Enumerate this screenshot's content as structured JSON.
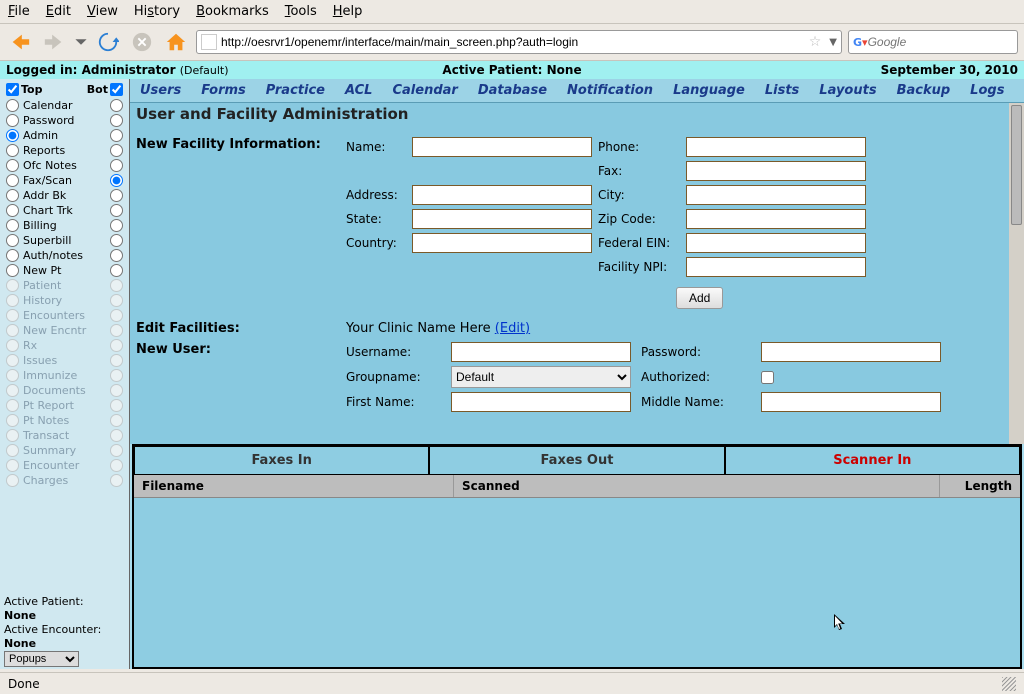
{
  "browser": {
    "menu": [
      "File",
      "Edit",
      "View",
      "History",
      "Bookmarks",
      "Tools",
      "Help"
    ],
    "url": "http://oesrvr1/openemr/interface/main/main_screen.php?auth=login",
    "search_placeholder": "Google"
  },
  "statusbar": {
    "logged_in_label": "Logged in: ",
    "user": "Administrator",
    "user_default": "(Default)",
    "active_patient_label": "Active Patient: ",
    "active_patient": "None",
    "date": "September 30, 2010"
  },
  "sidebar": {
    "top_label": "Top",
    "bot_label": "Bot",
    "items": [
      {
        "label": "Calendar",
        "enabled": true,
        "sel": false
      },
      {
        "label": "Password",
        "enabled": true,
        "sel": false
      },
      {
        "label": "Admin",
        "enabled": true,
        "sel": true
      },
      {
        "label": "Reports",
        "enabled": true,
        "sel": false
      },
      {
        "label": "Ofc Notes",
        "enabled": true,
        "sel": false
      },
      {
        "label": "Fax/Scan",
        "enabled": true,
        "sel": false,
        "botsel": true
      },
      {
        "label": "Addr Bk",
        "enabled": true,
        "sel": false
      },
      {
        "label": "Chart Trk",
        "enabled": true,
        "sel": false
      },
      {
        "label": "Billing",
        "enabled": true,
        "sel": false
      },
      {
        "label": "Superbill",
        "enabled": true,
        "sel": false
      },
      {
        "label": "Auth/notes",
        "enabled": true,
        "sel": false
      },
      {
        "label": "New Pt",
        "enabled": true,
        "sel": false
      },
      {
        "label": "Patient",
        "enabled": false
      },
      {
        "label": "History",
        "enabled": false
      },
      {
        "label": "Encounters",
        "enabled": false
      },
      {
        "label": "New Encntr",
        "enabled": false
      },
      {
        "label": "Rx",
        "enabled": false
      },
      {
        "label": "Issues",
        "enabled": false
      },
      {
        "label": "Immunize",
        "enabled": false
      },
      {
        "label": "Documents",
        "enabled": false
      },
      {
        "label": "Pt Report",
        "enabled": false
      },
      {
        "label": "Pt Notes",
        "enabled": false
      },
      {
        "label": "Transact",
        "enabled": false
      },
      {
        "label": "Summary",
        "enabled": false
      },
      {
        "label": "Encounter",
        "enabled": false
      },
      {
        "label": "Charges",
        "enabled": false
      }
    ],
    "footer": {
      "active_patient_label": "Active Patient:",
      "active_patient": "None",
      "active_encounter_label": "Active Encounter:",
      "active_encounter": "None",
      "popups_label": "Popups"
    }
  },
  "topnav": [
    "Users",
    "Forms",
    "Practice",
    "ACL",
    "Calendar",
    "Database",
    "Notification",
    "Language",
    "Lists",
    "Layouts",
    "Backup",
    "Logs"
  ],
  "page": {
    "title": "User and Facility Administration",
    "new_facility": {
      "heading": "New Facility Information:",
      "labels": {
        "name": "Name:",
        "phone": "Phone:",
        "fax": "Fax:",
        "address": "Address:",
        "city": "City:",
        "state": "State:",
        "zip": "Zip Code:",
        "country": "Country:",
        "ein": "Federal EIN:",
        "npi": "Facility NPI:"
      },
      "add_button": "Add"
    },
    "edit_facilities": {
      "heading": "Edit Facilities:",
      "clinic_name": "Your Clinic Name Here",
      "edit_link": "(Edit)"
    },
    "new_user": {
      "heading": "New User:",
      "labels": {
        "username": "Username:",
        "password": "Password:",
        "groupname": "Groupname:",
        "authorized": "Authorized:",
        "first_name": "First Name:",
        "middle_name": "Middle Name:"
      },
      "group_default": "Default"
    }
  },
  "fax": {
    "tabs": [
      "Faxes In",
      "Faxes Out",
      "Scanner In"
    ],
    "active_tab": 2,
    "columns": [
      "Filename",
      "Scanned",
      "Length"
    ]
  },
  "footer": {
    "status": "Done"
  }
}
